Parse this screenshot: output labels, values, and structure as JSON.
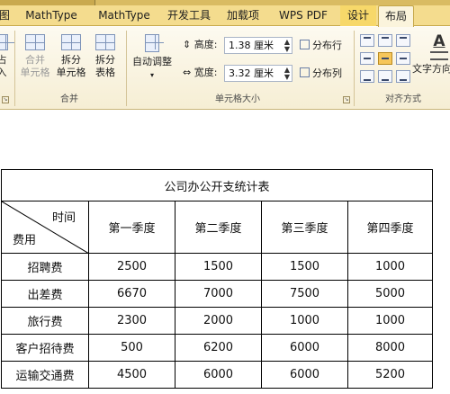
{
  "ribbon_tabs": [
    {
      "label": "图"
    },
    {
      "label": "MathType"
    },
    {
      "label": "MathType"
    },
    {
      "label": "开发工具"
    },
    {
      "label": "加载项"
    },
    {
      "label": "WPS PDF"
    },
    {
      "label": "设计"
    },
    {
      "label": "布局"
    }
  ],
  "ribbon": {
    "partial_left": {
      "line1": "占",
      "line2": "入"
    },
    "merge_group": {
      "label": "合并",
      "merge_cells": {
        "line1": "合并",
        "line2": "单元格"
      },
      "split_cells": {
        "line1": "拆分",
        "line2": "单元格"
      },
      "split_table": {
        "line1": "拆分",
        "line2": "表格"
      }
    },
    "cell_size_group": {
      "label": "单元格大小",
      "autofit": "自动调整",
      "height_label": "高度:",
      "height_value": "1.38 厘米",
      "width_label": "宽度:",
      "width_value": "3.32 厘米",
      "distribute_rows": "分布行",
      "distribute_cols": "分布列"
    },
    "alignment_group": {
      "label": "对齐方式",
      "text_direction": "文字方向",
      "text_direction_glyph": "A"
    }
  },
  "table": {
    "caption": "公司办公开支统计表",
    "corner_top": "时间",
    "corner_bottom": "费用",
    "columns": [
      "第一季度",
      "第二季度",
      "第三季度",
      "第四季度"
    ],
    "rows": [
      {
        "label": "招聘费",
        "values": [
          "2500",
          "1500",
          "1500",
          "1000"
        ]
      },
      {
        "label": "出差费",
        "values": [
          "6670",
          "7000",
          "7500",
          "5000"
        ]
      },
      {
        "label": "旅行费",
        "values": [
          "2300",
          "2000",
          "1000",
          "1000"
        ]
      },
      {
        "label": "客户招待费",
        "values": [
          "500",
          "6200",
          "6000",
          "8000"
        ]
      },
      {
        "label": "运输交通费",
        "values": [
          "4500",
          "6000",
          "6000",
          "5200"
        ]
      }
    ]
  }
}
